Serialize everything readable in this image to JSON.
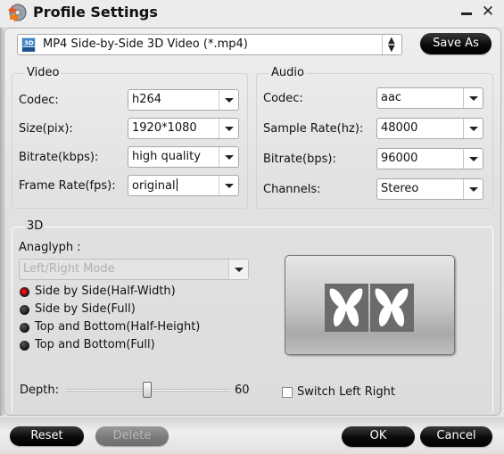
{
  "window": {
    "title": "Profile Settings",
    "minimize_icon": "minimize-icon",
    "close_icon": "close-icon",
    "close_glyph": "✕"
  },
  "profile": {
    "selected": "MP4 Side-by-Side 3D Video (*.mp4)",
    "icon": "mp4-3d-file-icon",
    "spinner_glyph": "▲▼",
    "save_as_label": "Save As"
  },
  "video": {
    "title": "Video",
    "fields": [
      {
        "label": "Codec:",
        "value": "h264"
      },
      {
        "label": "Size(pix):",
        "value": "1920*1080"
      },
      {
        "label": "Bitrate(kbps):",
        "value": "high quality"
      },
      {
        "label": "Frame Rate(fps):",
        "value": "original"
      }
    ]
  },
  "audio": {
    "title": "Audio",
    "fields": [
      {
        "label": "Codec:",
        "value": "aac"
      },
      {
        "label": "Sample Rate(hz):",
        "value": "48000"
      },
      {
        "label": "Bitrate(bps):",
        "value": "96000"
      },
      {
        "label": "Channels:",
        "value": "Stereo"
      }
    ]
  },
  "threed": {
    "title": "3D",
    "anaglyph_label": "Anaglyph :",
    "anaglyph_value": "Left/Right Mode",
    "modes": [
      {
        "label": "Side by Side(Half-Width)",
        "checked": true
      },
      {
        "label": "Side by Side(Full)",
        "checked": false
      },
      {
        "label": "Top and Bottom(Half-Height)",
        "checked": false
      },
      {
        "label": "Top and Bottom(Full)",
        "checked": false
      }
    ],
    "preview_icon": "side-by-side-butterfly-preview",
    "depth_label": "Depth:",
    "depth_value": "60",
    "switch_label": "Switch Left Right",
    "switch_checked": false
  },
  "buttons": {
    "reset": "Reset",
    "delete": "Delete",
    "ok": "OK",
    "cancel": "Cancel"
  },
  "colors": {
    "accent_radio": "#cc0000",
    "button_dark": "#0a0a0a",
    "button_disabled": "#7a7a7a"
  }
}
